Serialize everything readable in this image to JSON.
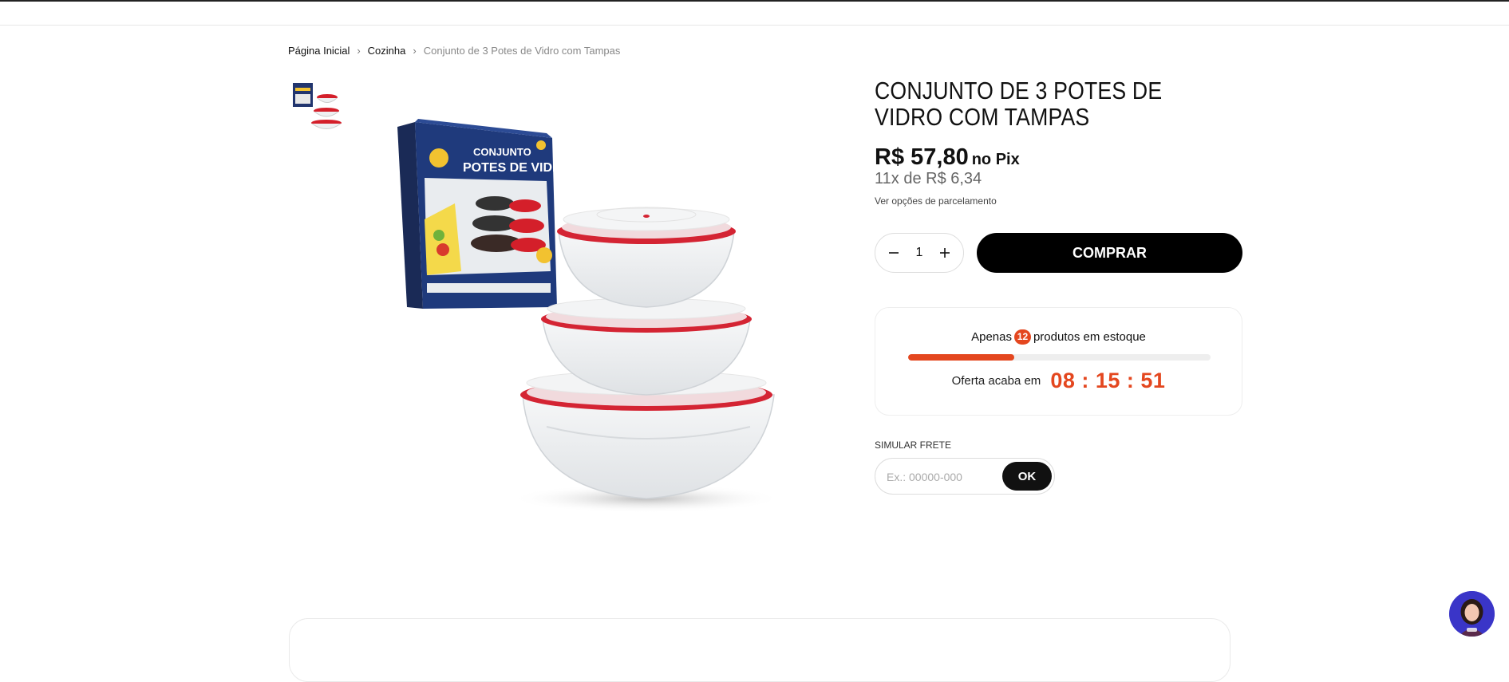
{
  "breadcrumb": {
    "home": "Página Inicial",
    "category": "Cozinha",
    "current": "Conjunto de 3 Potes de Vidro com Tampas"
  },
  "product": {
    "title": "CONJUNTO DE 3 POTES DE VIDRO COM TAMPAS",
    "price": "R$ 57,80",
    "price_suffix": "no Pix",
    "installment": "11x de R$ 6,34",
    "installment_link": "Ver opções de parcelamento",
    "package_text_top": "CONJUNTO",
    "package_text_bottom": "POTES DE VIDRO"
  },
  "purchase": {
    "quantity": "1",
    "buy_label": "COMPRAR"
  },
  "stock": {
    "prefix": "Apenas",
    "count": "12",
    "suffix": "produtos em estoque",
    "progress_fraction": 0.35,
    "offer_label": "Oferta acaba em",
    "timer": "08 : 15 : 51"
  },
  "shipping": {
    "label": "SIMULAR FRETE",
    "placeholder": "Ex.: 00000-000",
    "button": "OK"
  },
  "colors": {
    "accent": "#e4471f",
    "button": "#000000",
    "chat_bg": "#3a35c8"
  }
}
